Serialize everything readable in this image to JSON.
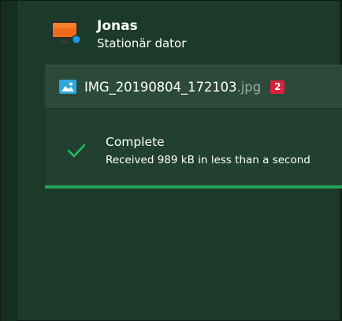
{
  "device": {
    "name": "Jonas",
    "type": "Stationär dator",
    "icon": "desktop-monitor-icon",
    "status_dot_color": "#1e9bf0"
  },
  "transfer": {
    "file_name": "IMG_20190804_172103",
    "file_ext": ".jpg",
    "file_icon": "image-icon",
    "badge_count": "2",
    "badge_color": "#d9233a"
  },
  "status": {
    "icon": "checkmark-icon",
    "title": "Complete",
    "detail": "Received 989 kB in less than a second",
    "progress": 1.0,
    "progress_color": "#22a05a"
  }
}
